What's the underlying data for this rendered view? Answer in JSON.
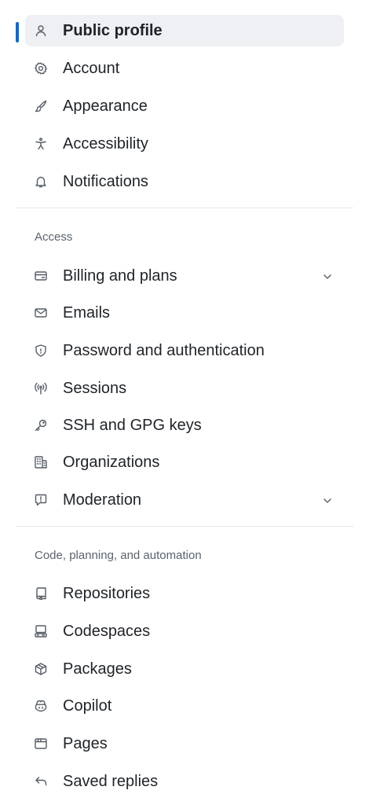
{
  "nav": {
    "items_top": [
      {
        "label": "Public profile",
        "icon": "person-icon",
        "selected": true
      },
      {
        "label": "Account",
        "icon": "gear-icon"
      },
      {
        "label": "Appearance",
        "icon": "paintbrush-icon"
      },
      {
        "label": "Accessibility",
        "icon": "accessibility-icon"
      },
      {
        "label": "Notifications",
        "icon": "bell-icon"
      }
    ],
    "access": {
      "heading": "Access",
      "items": [
        {
          "label": "Billing and plans",
          "icon": "credit-card-icon",
          "expandable": true
        },
        {
          "label": "Emails",
          "icon": "mail-icon"
        },
        {
          "label": "Password and authentication",
          "icon": "shield-lock-icon"
        },
        {
          "label": "Sessions",
          "icon": "broadcast-icon"
        },
        {
          "label": "SSH and GPG keys",
          "icon": "key-icon"
        },
        {
          "label": "Organizations",
          "icon": "organization-icon"
        },
        {
          "label": "Moderation",
          "icon": "report-icon",
          "expandable": true
        }
      ]
    },
    "code": {
      "heading": "Code, planning, and automation",
      "items": [
        {
          "label": "Repositories",
          "icon": "repo-icon"
        },
        {
          "label": "Codespaces",
          "icon": "codespaces-icon"
        },
        {
          "label": "Packages",
          "icon": "package-icon"
        },
        {
          "label": "Copilot",
          "icon": "copilot-icon"
        },
        {
          "label": "Pages",
          "icon": "browser-icon"
        },
        {
          "label": "Saved replies",
          "icon": "reply-icon"
        }
      ]
    }
  },
  "colors": {
    "accent": "#0969da",
    "selected_bg": "#eef0f3",
    "text": "#1f2328",
    "muted": "#59636e",
    "divider": "#e5e7ea"
  }
}
